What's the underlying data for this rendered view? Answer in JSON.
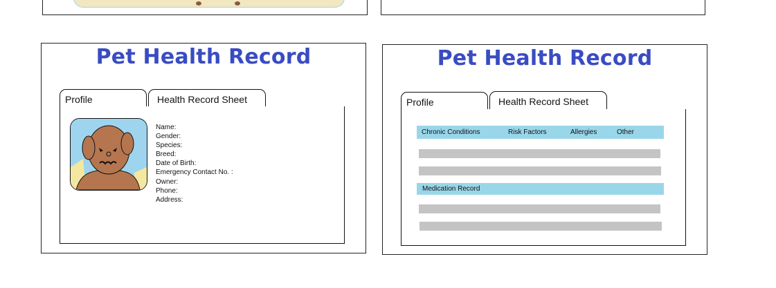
{
  "cards": [
    {
      "title": "Pet Health Record",
      "tabs": [
        "Profile",
        "Health Record Sheet"
      ],
      "profile_fields": [
        "Name:",
        "Gender:",
        "Species:",
        "Breed:",
        "Date of Birth:",
        "Emergency Contact No. :",
        "Owner:",
        "Phone:",
        "Address:"
      ]
    },
    {
      "title": "Pet Health Record",
      "tabs": [
        "Profile",
        "Health Record Sheet"
      ],
      "conditions_header": [
        "Chronic Conditions",
        "Risk Factors",
        "Allergies",
        "Other"
      ],
      "medication_header": "Medication Record"
    }
  ],
  "icons": [
    "pet-avatar-icon"
  ],
  "colors": {
    "title": "#3a4cc2",
    "section_header": "#99d6ea",
    "placeholder_bar": "#c4c4c4",
    "avatar_background": "#9fd4ee",
    "pet_fur": "#b5764f"
  }
}
